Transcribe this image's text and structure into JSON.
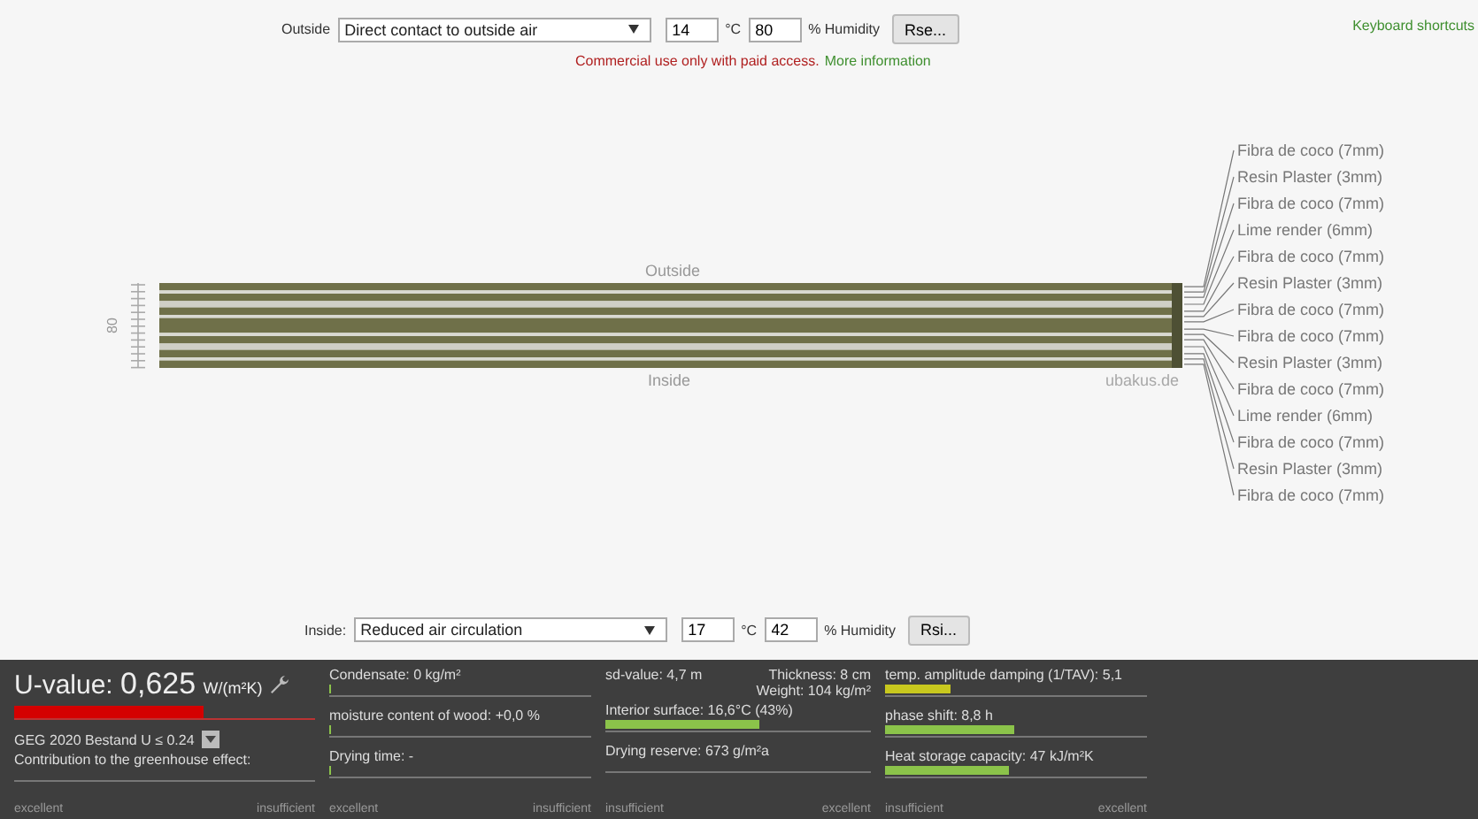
{
  "outside": {
    "label": "Outside",
    "select": "Direct contact to outside air",
    "temperature": "14",
    "temp_unit": "°C",
    "humidity": "80",
    "humidity_label": "% Humidity",
    "button": "Rse..."
  },
  "notice": {
    "text": "Commercial use only with paid access.",
    "link": "More information"
  },
  "shortcuts_link": "Keyboard shortcuts",
  "diagram": {
    "outside_label": "Outside",
    "inside_label": "Inside",
    "watermark": "ubakus.de",
    "ruler_label": "80",
    "layers": [
      {
        "name": "Fibra de coco (7mm)",
        "kind": "fibre"
      },
      {
        "name": "Resin Plaster (3mm)",
        "kind": "plaster"
      },
      {
        "name": "Fibra de coco (7mm)",
        "kind": "fibre"
      },
      {
        "name": "Lime render (6mm)",
        "kind": "render"
      },
      {
        "name": "Fibra de coco (7mm)",
        "kind": "fibre"
      },
      {
        "name": "Resin Plaster (3mm)",
        "kind": "plaster"
      },
      {
        "name": "Fibra de coco (7mm)",
        "kind": "fibre"
      },
      {
        "name": "Fibra de coco (7mm)",
        "kind": "fibre"
      },
      {
        "name": "Resin Plaster (3mm)",
        "kind": "plaster"
      },
      {
        "name": "Fibra de coco (7mm)",
        "kind": "fibre"
      },
      {
        "name": "Lime render (6mm)",
        "kind": "render"
      },
      {
        "name": "Fibra de coco (7mm)",
        "kind": "fibre"
      },
      {
        "name": "Resin Plaster (3mm)",
        "kind": "plaster"
      },
      {
        "name": "Fibra de coco (7mm)",
        "kind": "fibre"
      }
    ]
  },
  "inside": {
    "label": "Inside:",
    "select": "Reduced air circulation",
    "temperature": "17",
    "temp_unit": "°C",
    "humidity": "42",
    "humidity_label": "% Humidity",
    "button": "Rsi..."
  },
  "results": {
    "u_value": {
      "label": "U-value:",
      "value": "0,625",
      "unit": "W/(m²K)",
      "level": 0.63,
      "color": "#d40000"
    },
    "standard": "GEG 2020 Bestand U ≤ 0.24",
    "greenhouse": {
      "label": "Contribution to the greenhouse effect:"
    },
    "scale": {
      "left": "excellent",
      "right": "insufficient"
    },
    "columns": [
      {
        "metrics": [
          {
            "label": "Condensate: 0 kg/m²",
            "level": 0.01,
            "color": "#8bc34a"
          },
          {
            "label": "moisture content of wood: +0,0 %",
            "level": 0.01,
            "color": "#8bc34a"
          },
          {
            "label": "Drying time: -",
            "level": 0.01,
            "color": "#8bc34a"
          }
        ],
        "scale": {
          "left": "excellent",
          "right": "insufficient"
        }
      },
      {
        "metrics": [
          {
            "label": "sd-value: 4,7 m",
            "notes": [
              "Thickness: 8 cm",
              "Weight: 104 kg/m²"
            ]
          },
          {
            "label": "Interior surface: 16,6°C (43%)",
            "level": 0.58,
            "color": "#8bc34a"
          },
          {
            "label": "Drying reserve: 673 g/m²a"
          }
        ],
        "scale": {
          "left": "insufficient",
          "right": "excellent"
        }
      },
      {
        "metrics": [
          {
            "label": "temp. amplitude damping (1/TAV): 5,1",
            "level": 0.25,
            "color": "#c8c81e"
          },
          {
            "label": "phase shift: 8,8 h",
            "level": 0.49,
            "color": "#8bc34a"
          },
          {
            "label": "Heat storage capacity: 47 kJ/m²K",
            "level": 0.47,
            "color": "#8bc34a"
          }
        ],
        "scale": {
          "left": "insufficient",
          "right": "excellent"
        }
      }
    ]
  }
}
